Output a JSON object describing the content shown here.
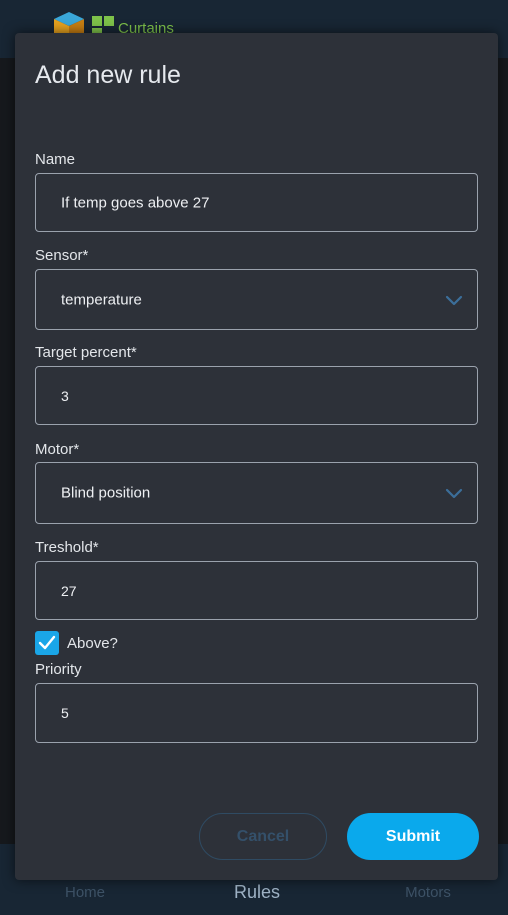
{
  "app": {
    "brand": "Curtains",
    "nav": [
      {
        "label": "Home"
      },
      {
        "label": "Rules"
      },
      {
        "label": "Motors"
      }
    ]
  },
  "dialog": {
    "title": "Add new rule",
    "fields": {
      "name": {
        "label": "Name",
        "value": "If temp goes above 27"
      },
      "sensor": {
        "label": "Sensor*",
        "value": "temperature",
        "icon": "chevron-down-icon"
      },
      "target_percent": {
        "label": "Target percent*",
        "value": "3"
      },
      "motor": {
        "label": "Motor*",
        "value": "Blind position",
        "icon": "chevron-down-icon"
      },
      "threshold": {
        "label": "Treshold*",
        "value": "27"
      },
      "above": {
        "label": "Above?",
        "checked": true
      },
      "priority": {
        "label": "Priority",
        "value": "5"
      }
    },
    "actions": {
      "cancel_label": "Cancel",
      "submit_label": "Submit"
    }
  },
  "colors": {
    "accent": "#0aa9ec",
    "dialog_bg": "#2d3139",
    "header_bg": "#182634",
    "brand_green": "#7ec24a"
  }
}
